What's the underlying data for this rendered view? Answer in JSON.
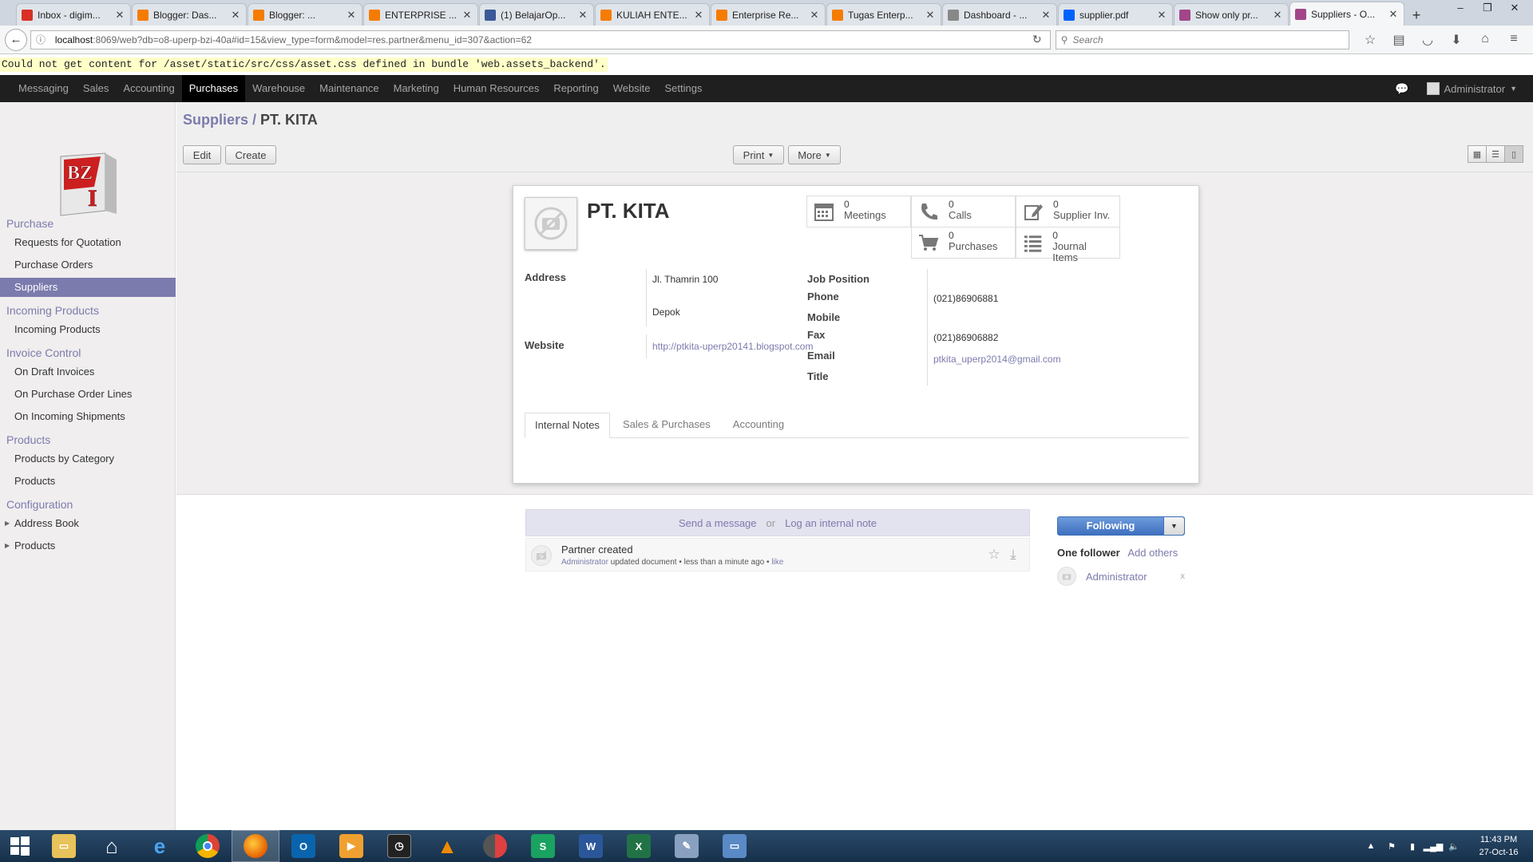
{
  "browser": {
    "tabs": [
      {
        "label": "Inbox - digim...",
        "color": "#d93025",
        "active": false
      },
      {
        "label": "Blogger: Das...",
        "color": "#f57c00",
        "active": false
      },
      {
        "label": "Blogger: ...",
        "color": "#f57c00",
        "active": false
      },
      {
        "label": "ENTERPRISE ...",
        "color": "#f57c00",
        "active": false
      },
      {
        "label": "(1) BelajarOp...",
        "color": "#3b5998",
        "active": false
      },
      {
        "label": "KULIAH ENTE...",
        "color": "#f57c00",
        "active": false
      },
      {
        "label": "Enterprise Re...",
        "color": "#f57c00",
        "active": false
      },
      {
        "label": "Tugas Enterp...",
        "color": "#f57c00",
        "active": false
      },
      {
        "label": "Dashboard - ...",
        "color": "#888888",
        "active": false
      },
      {
        "label": "supplier.pdf",
        "color": "#0061ff",
        "active": false
      },
      {
        "label": "Show only pr...",
        "color": "#a24689",
        "active": false
      },
      {
        "label": "Suppliers - O...",
        "color": "#a24689",
        "active": true
      }
    ],
    "url_host": "localhost",
    "url_rest": ":8069/web?db=o8-uperp-bzi-40a#id=15&view_type=form&model=res.partner&menu_id=307&action=62",
    "search_placeholder": "Search"
  },
  "error_message": "Could not get content for /asset/static/src/css/asset.css defined in bundle 'web.assets_backend'.",
  "topmenu": {
    "items": [
      "Messaging",
      "Sales",
      "Accounting",
      "Purchases",
      "Warehouse",
      "Maintenance",
      "Marketing",
      "Human Resources",
      "Reporting",
      "Website",
      "Settings"
    ],
    "active": "Purchases",
    "user": "Administrator"
  },
  "sidebar": {
    "sections": [
      {
        "title": "Purchase",
        "items": [
          "Requests for Quotation",
          "Purchase Orders",
          "Suppliers"
        ]
      },
      {
        "title": "Incoming Products",
        "items": [
          "Incoming Products"
        ]
      },
      {
        "title": "Invoice Control",
        "items": [
          "On Draft Invoices",
          "On Purchase Order Lines",
          "On Incoming Shipments"
        ]
      },
      {
        "title": "Products",
        "items": [
          "Products by Category",
          "Products"
        ]
      },
      {
        "title": "Configuration",
        "items": [
          "Address Book",
          "Products"
        ]
      }
    ],
    "active_item": "Suppliers"
  },
  "breadcrumb": {
    "parent": "Suppliers",
    "sep": "/",
    "current": "PT. KITA"
  },
  "buttons": {
    "edit": "Edit",
    "create": "Create",
    "print": "Print",
    "more": "More"
  },
  "partner": {
    "name": "PT. KITA",
    "stats": [
      {
        "count": "0",
        "label": "Meetings",
        "icon": "calendar-icon"
      },
      {
        "count": "0",
        "label": "Calls",
        "icon": "phone-icon"
      },
      {
        "count": "0",
        "label": "Supplier Inv.",
        "icon": "pencil-icon"
      },
      {
        "count": "0",
        "label": "Purchases",
        "icon": "cart-icon"
      },
      {
        "count": "0",
        "label": "Journal Items",
        "icon": "list-icon"
      }
    ],
    "labels": {
      "address": "Address",
      "website": "Website",
      "job_position": "Job Position",
      "phone": "Phone",
      "mobile": "Mobile",
      "fax": "Fax",
      "email": "Email",
      "title": "Title"
    },
    "street": "Jl. Thamrin 100",
    "city": "Depok",
    "website": "http://ptkita-uperp20141.blogspot.com",
    "phone": "(021)86906881",
    "fax": "(021)86906882",
    "email": "ptkita_uperp2014@gmail.com"
  },
  "form_tabs": [
    "Internal Notes",
    "Sales & Purchases",
    "Accounting"
  ],
  "chatter": {
    "send_message": "Send a message",
    "or": "or",
    "log_note": "Log an internal note",
    "message_title": "Partner created",
    "message_author": "Administrator",
    "message_action": "updated document",
    "message_time": "less than a minute ago",
    "message_like": "like",
    "following": "Following",
    "followers_count": "One follower",
    "add_others": "Add others",
    "follower_name": "Administrator",
    "remove": "x"
  },
  "taskbar": {
    "time": "11:43 PM",
    "date": "27-Oct-16"
  }
}
